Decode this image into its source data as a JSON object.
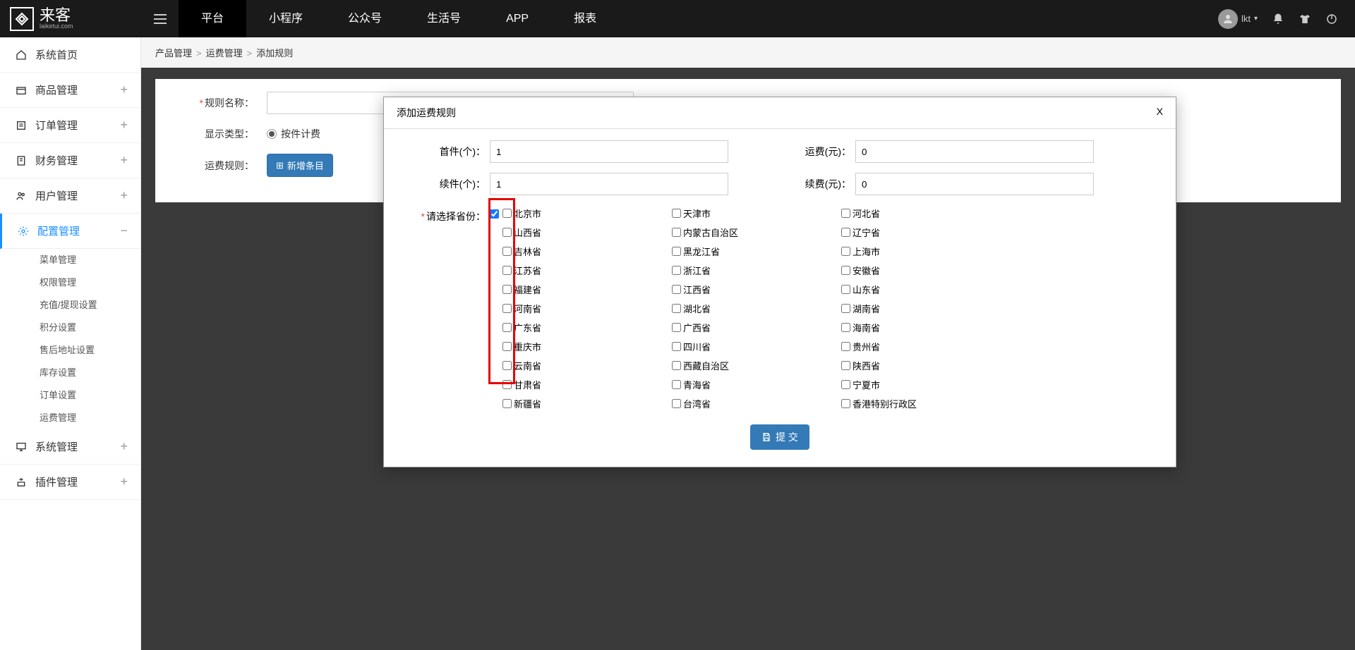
{
  "header": {
    "brand_title": "来客",
    "brand_sub": "laiketui.com",
    "nav": [
      "平台",
      "小程序",
      "公众号",
      "生活号",
      "APP",
      "报表"
    ],
    "active_nav_index": 0,
    "user_label": "lkt"
  },
  "sidebar": {
    "items": [
      {
        "label": "系统首页",
        "icon": "home",
        "expand": false
      },
      {
        "label": "商品管理",
        "icon": "box",
        "expand": true
      },
      {
        "label": "订单管理",
        "icon": "list",
        "expand": true
      },
      {
        "label": "财务管理",
        "icon": "doc",
        "expand": true
      },
      {
        "label": "用户管理",
        "icon": "users",
        "expand": true
      },
      {
        "label": "配置管理",
        "icon": "gear",
        "expand": true,
        "active": true
      },
      {
        "label": "系统管理",
        "icon": "monitor",
        "expand": true
      },
      {
        "label": "插件管理",
        "icon": "plugin",
        "expand": true
      }
    ],
    "sub_items": [
      "菜单管理",
      "权限管理",
      "充值/提现设置",
      "积分设置",
      "售后地址设置",
      "库存设置",
      "订单设置",
      "运费管理"
    ]
  },
  "breadcrumb": {
    "items": [
      "产品管理",
      "运费管理",
      "添加规则"
    ]
  },
  "form": {
    "rule_name_label": "规则名称：",
    "display_type_label": "显示类型：",
    "display_type_value": "按件计费",
    "freight_rule_label": "运费规则：",
    "add_button": "新增条目"
  },
  "modal": {
    "title": "添加运费规则",
    "close": "X",
    "first_piece_label": "首件(个)：",
    "first_piece_value": "1",
    "freight_label": "运费(元)：",
    "freight_value": "0",
    "cont_piece_label": "续件(个)：",
    "cont_piece_value": "1",
    "cont_fee_label": "续费(元)：",
    "cont_fee_value": "0",
    "province_label": "请选择省份：",
    "provinces": [
      "北京市",
      "天津市",
      "河北省",
      "山西省",
      "内蒙古自治区",
      "辽宁省",
      "吉林省",
      "黑龙江省",
      "上海市",
      "江苏省",
      "浙江省",
      "安徽省",
      "福建省",
      "江西省",
      "山东省",
      "河南省",
      "湖北省",
      "湖南省",
      "广东省",
      "广西省",
      "海南省",
      "重庆市",
      "四川省",
      "贵州省",
      "云南省",
      "西藏自治区",
      "陕西省",
      "甘肃省",
      "青海省",
      "宁夏市",
      "新疆省",
      "台湾省",
      "香港特别行政区"
    ],
    "checked_province_index": 0,
    "submit_text": "提 交"
  }
}
